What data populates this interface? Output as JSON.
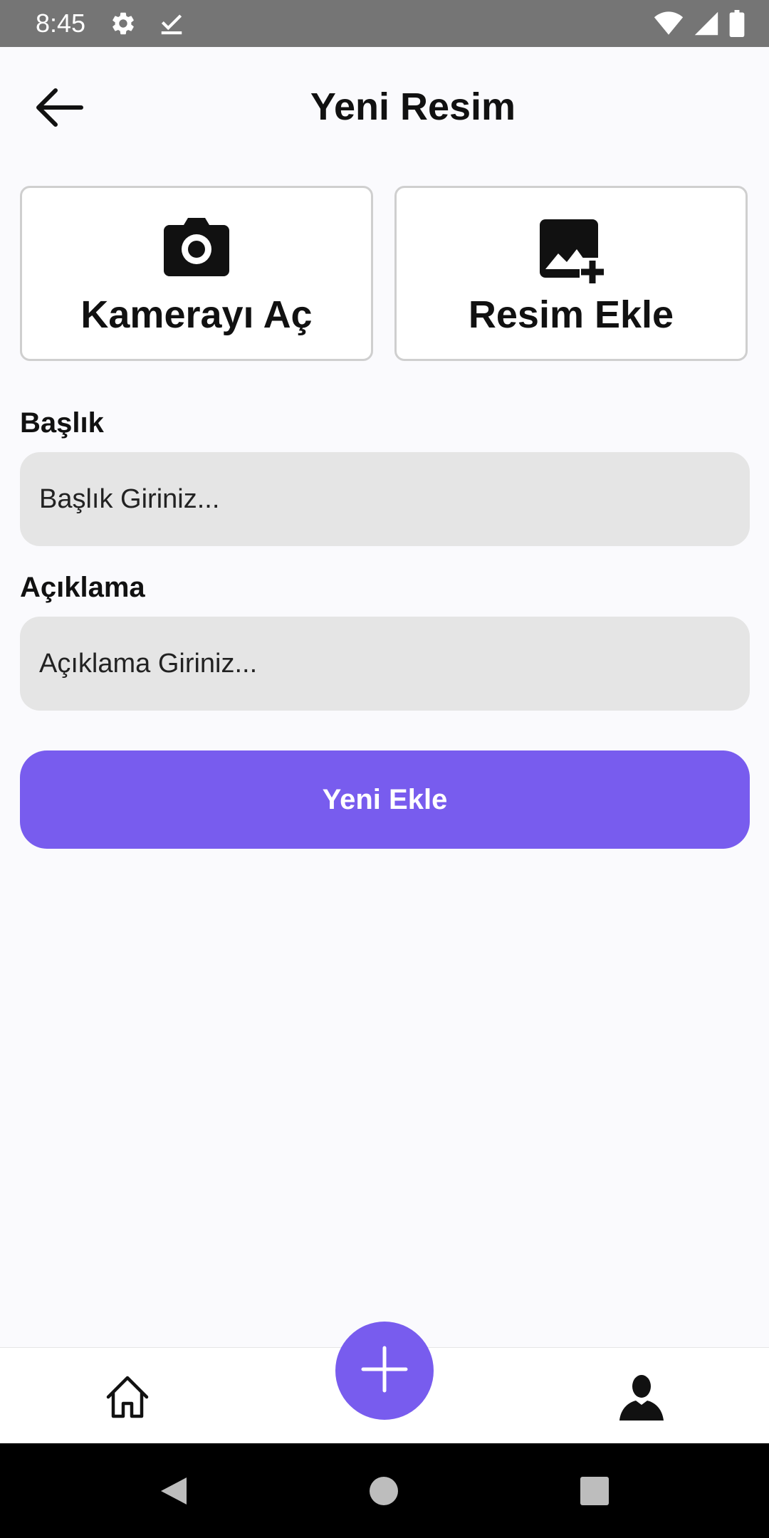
{
  "status_bar": {
    "time": "8:45",
    "left_icons": [
      "settings-icon",
      "check-icon"
    ],
    "right_icons": [
      "wifi-icon",
      "signal-icon",
      "battery-icon"
    ]
  },
  "header": {
    "title": "Yeni Resim",
    "back_icon": "arrow-left-icon"
  },
  "actions": {
    "camera": {
      "label": "Kamerayı Aç",
      "icon": "camera-icon"
    },
    "gallery": {
      "label": "Resim Ekle",
      "icon": "add-photo-icon"
    }
  },
  "form": {
    "title_label": "Başlık",
    "title_placeholder": "Başlık Giriniz...",
    "title_value": "",
    "desc_label": "Açıklama",
    "desc_placeholder": "Açıklama Giriniz...",
    "desc_value": "",
    "submit_label": "Yeni Ekle"
  },
  "bottom_nav": {
    "items": [
      "home-icon",
      "add-icon",
      "profile-icon"
    ]
  },
  "colors": {
    "accent": "#785cee",
    "background": "#fafafd",
    "input_bg": "#e5e5e5",
    "status_bar": "#757575"
  }
}
